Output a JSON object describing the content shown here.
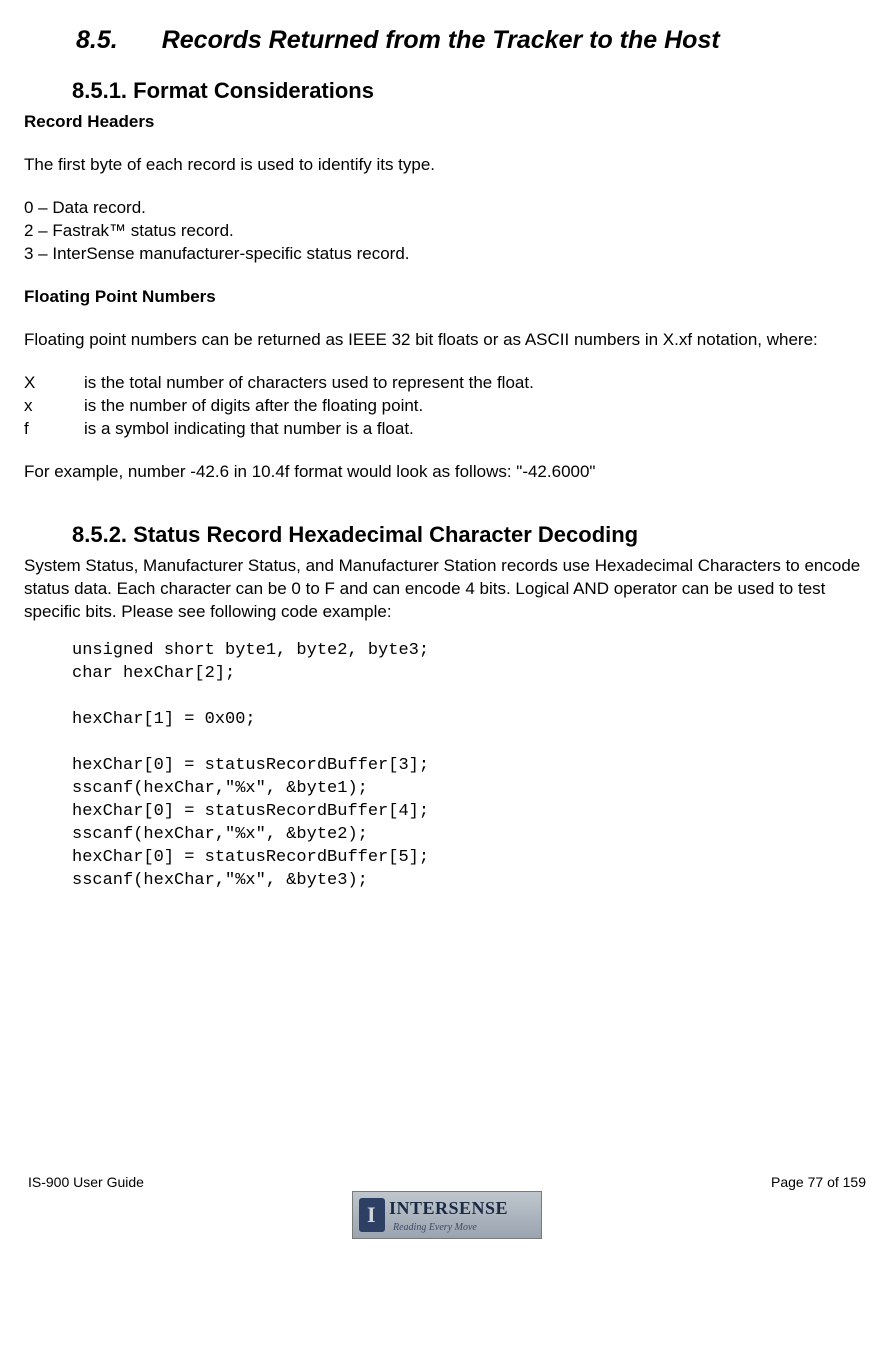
{
  "section": {
    "number": "8.5.",
    "title": "Records Returned from the Tracker to the Host"
  },
  "sub1": {
    "number": "8.5.1.",
    "title": "Format Considerations",
    "h_record_headers": "Record Headers",
    "p_first_byte": "The first byte of each record is used to identify its type.",
    "types": {
      "t0": "0 – Data record.",
      "t2": "2 – Fastrak™ status record.",
      "t3": "3 – InterSense manufacturer-specific status record."
    },
    "h_float": "Floating Point Numbers",
    "p_float_intro": "Floating point numbers can be returned as IEEE 32 bit floats or as ASCII numbers in X.xf notation, where:",
    "defs": {
      "X_sym": "X",
      "X_txt": "is the total number of characters used to represent the float.",
      "x_sym": "x",
      "x_txt": "is the number of digits after the floating point.",
      "f_sym": "f",
      "f_txt": "is a symbol indicating that number is a float."
    },
    "p_example": "For example, number -42.6 in 10.4f format would look as follows: \"-42.6000\""
  },
  "sub2": {
    "number": "8.5.2.",
    "title": "Status Record Hexadecimal Character Decoding",
    "p_intro": "System Status, Manufacturer Status, and Manufacturer Station records use Hexadecimal Characters to encode status data.  Each character can be 0 to F and can encode 4 bits.  Logical AND operator can be used to test specific bits.  Please see following code example:",
    "code": "unsigned short byte1, byte2, byte3;\nchar hexChar[2];\n\nhexChar[1] = 0x00;\n\nhexChar[0] = statusRecordBuffer[3];\nsscanf(hexChar,\"%x\", &byte1);\nhexChar[0] = statusRecordBuffer[4];\nsscanf(hexChar,\"%x\", &byte2);\nhexChar[0] = statusRecordBuffer[5];\nsscanf(hexChar,\"%x\", &byte3);"
  },
  "footer": {
    "left": "IS-900 User Guide",
    "right": "Page 77 of 159",
    "logo_main": "INTERSENSE",
    "logo_sub": "Reading Every Move"
  }
}
